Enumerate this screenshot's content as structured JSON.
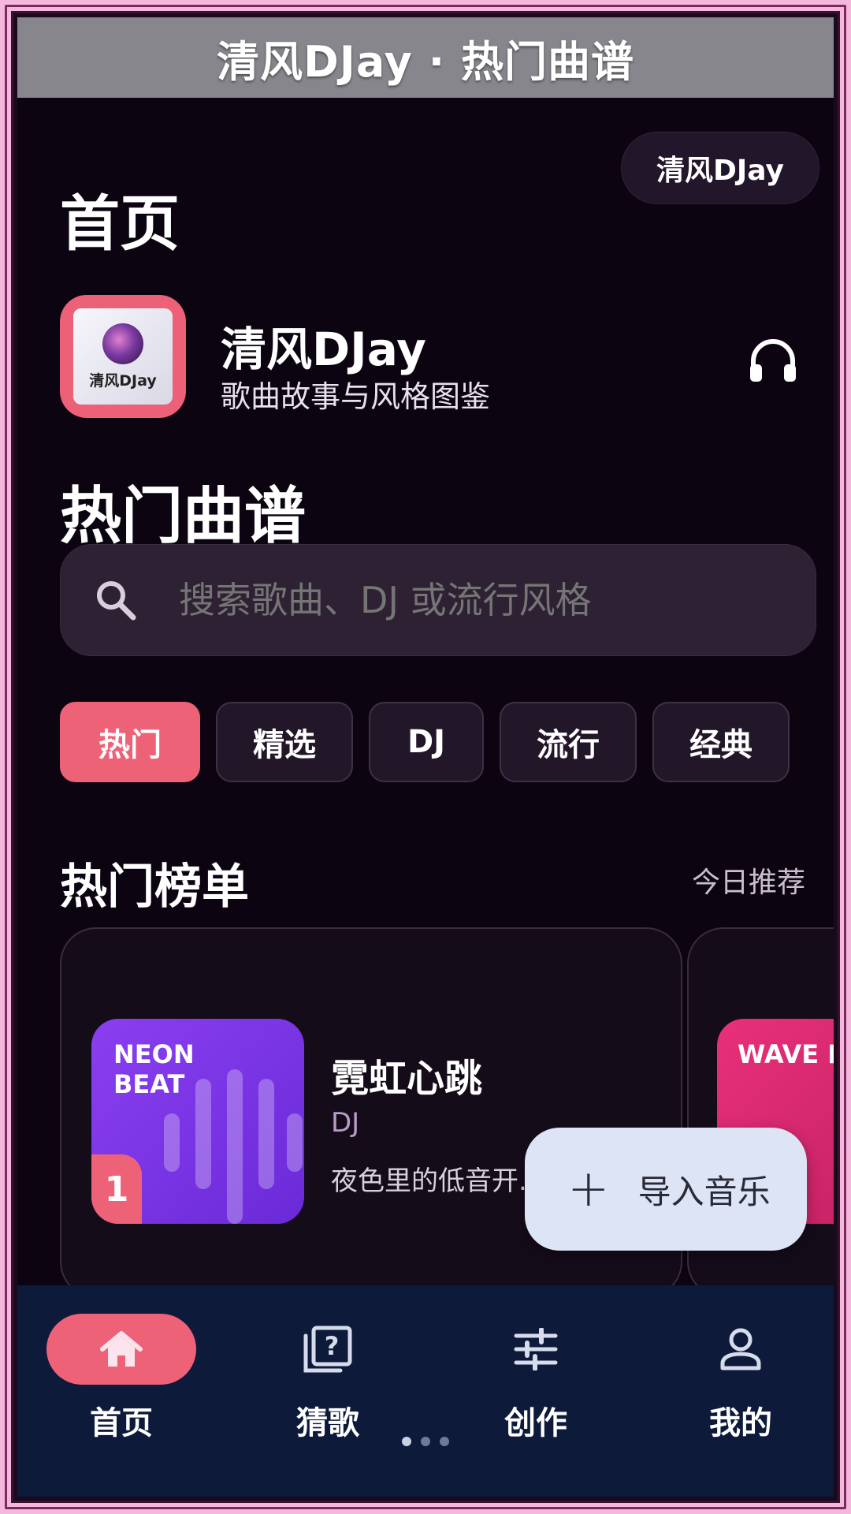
{
  "window": {
    "title": "清风DJay · 热门曲谱"
  },
  "header": {
    "page_title": "首页",
    "brand_pill": "清风DJay"
  },
  "app": {
    "name": "清风DJay",
    "subtitle": "歌曲故事与风格图鉴",
    "icon_text": "清风DJay",
    "headphones_icon": "headphones-icon"
  },
  "section": {
    "title": "热门曲谱"
  },
  "search": {
    "placeholder": "搜索歌曲、DJ 或流行风格",
    "value": ""
  },
  "tabs": [
    {
      "label": "热门",
      "active": true
    },
    {
      "label": "精选",
      "active": false
    },
    {
      "label": "DJ",
      "active": false
    },
    {
      "label": "流行",
      "active": false
    },
    {
      "label": "经典",
      "active": false
    }
  ],
  "chart": {
    "title": "热门榜单",
    "link": "今日推荐",
    "items": [
      {
        "cover_text": "NEON BEAT",
        "rank": "1",
        "title": "霓虹心跳",
        "genre": "DJ",
        "desc": "夜色里的低音开..."
      },
      {
        "cover_text": "WAVE PARTY"
      }
    ]
  },
  "fab": {
    "icon": "+",
    "label": "导入音乐"
  },
  "nav": [
    {
      "label": "首页",
      "icon": "home-icon",
      "active": true
    },
    {
      "label": "猜歌",
      "icon": "quiz-icon",
      "active": false
    },
    {
      "label": "创作",
      "icon": "sliders-icon",
      "active": false
    },
    {
      "label": "我的",
      "icon": "person-icon",
      "active": false
    }
  ],
  "colors": {
    "accent": "#ee6278",
    "background": "#0c0511",
    "nav_background": "#0d1a3a",
    "fab_background": "#dde4f6"
  }
}
